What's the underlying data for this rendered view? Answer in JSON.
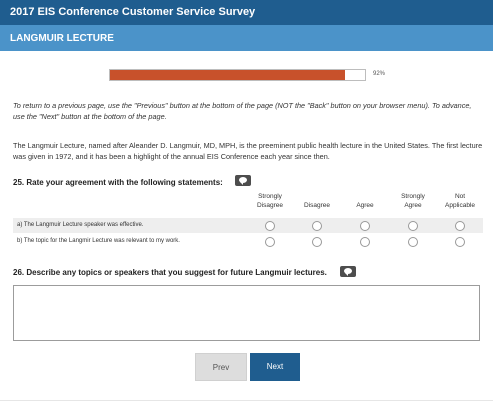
{
  "survey": {
    "title": "2017 EIS Conference Customer Service Survey",
    "section": "LANGMUIR LECTURE"
  },
  "progress": {
    "percent": 92,
    "label": "92%",
    "fill_color": "#c8512b"
  },
  "instructions": "To return to a previous page, use the \"Previous\" button at the bottom of the page (NOT the \"Back\" button on your browser menu). To advance, use the \"Next\" button at the bottom of the page.",
  "intro": "The Langmuir Lecture, named after Aleander D. Langmuir, MD, MPH, is the preeminent public health lecture in the United States. The first lecture was given in 1972, and it has been a highlight of the annual EIS Conference each year since then.",
  "question25": {
    "heading": "25. Rate your agreement with the following statements:",
    "comment_icon": "comment-icon",
    "columns": [
      {
        "line1": "Strongly",
        "line2": "Disagree"
      },
      {
        "line1": "",
        "line2": "Disagree"
      },
      {
        "line1": "",
        "line2": "Agree"
      },
      {
        "line1": "Strongly",
        "line2": "Agree"
      },
      {
        "line1": "Not",
        "line2": "Applicable"
      }
    ],
    "rows": [
      {
        "label": "a) The Langmuir Lecture speaker was effective."
      },
      {
        "label": "b) The topic for the Langmir Lecture was relevant to my work."
      }
    ]
  },
  "question26": {
    "heading": "26. Describe any topics or speakers that you suggest for future Langmuir lectures.",
    "comment_icon": "comment-icon",
    "answer": ""
  },
  "nav": {
    "prev_label": "Prev",
    "next_label": "Next"
  },
  "colors": {
    "header": "#1f5d8f",
    "section": "#4b93c9",
    "next_button": "#1f5d8f"
  }
}
